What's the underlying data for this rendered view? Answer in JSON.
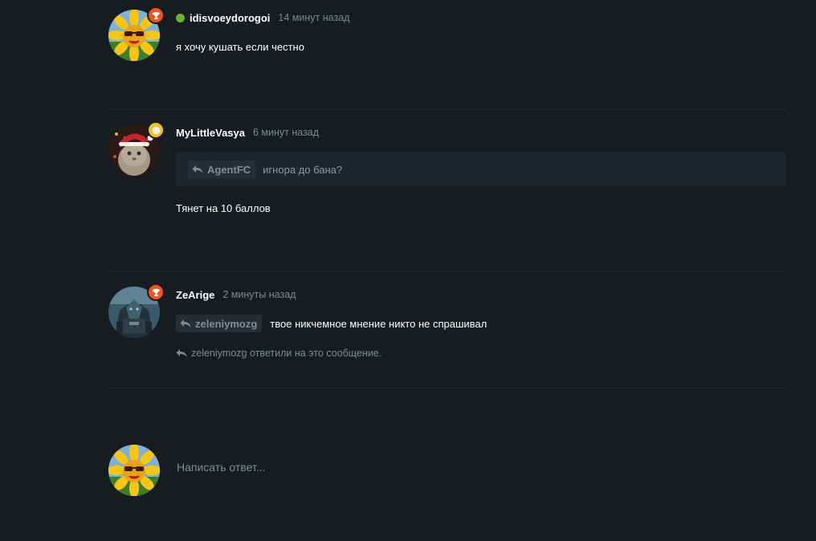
{
  "comments": [
    {
      "username": "idisvoeydorogoi",
      "time": "14 минут назад",
      "online": true,
      "badge": "trophy-icon",
      "badge_color": "#f4511e",
      "text": "я хочу кушать если честно"
    },
    {
      "username": "MyLittleVasya",
      "time": "6 минут назад",
      "badge": "smile-icon",
      "badge_color": "#f5c02e",
      "quote": {
        "author": "AgentFC",
        "text": "игнора до бана?"
      },
      "text": "Тянет на 10 баллов"
    },
    {
      "username": "ZeArige",
      "time": "2 минуты назад",
      "badge": "trophy-icon",
      "badge_color": "#f4511e",
      "reply_to": "zeleniymozg",
      "text": "твое никчемное мнение никто не спрашивал",
      "replied_notice": "zeleniymozg ответили на это сообщение."
    }
  ],
  "composer": {
    "placeholder": "Написать ответ..."
  },
  "colors": {
    "background": "#161c20",
    "muted": "#7e8d95",
    "online": "#6ab42d"
  }
}
